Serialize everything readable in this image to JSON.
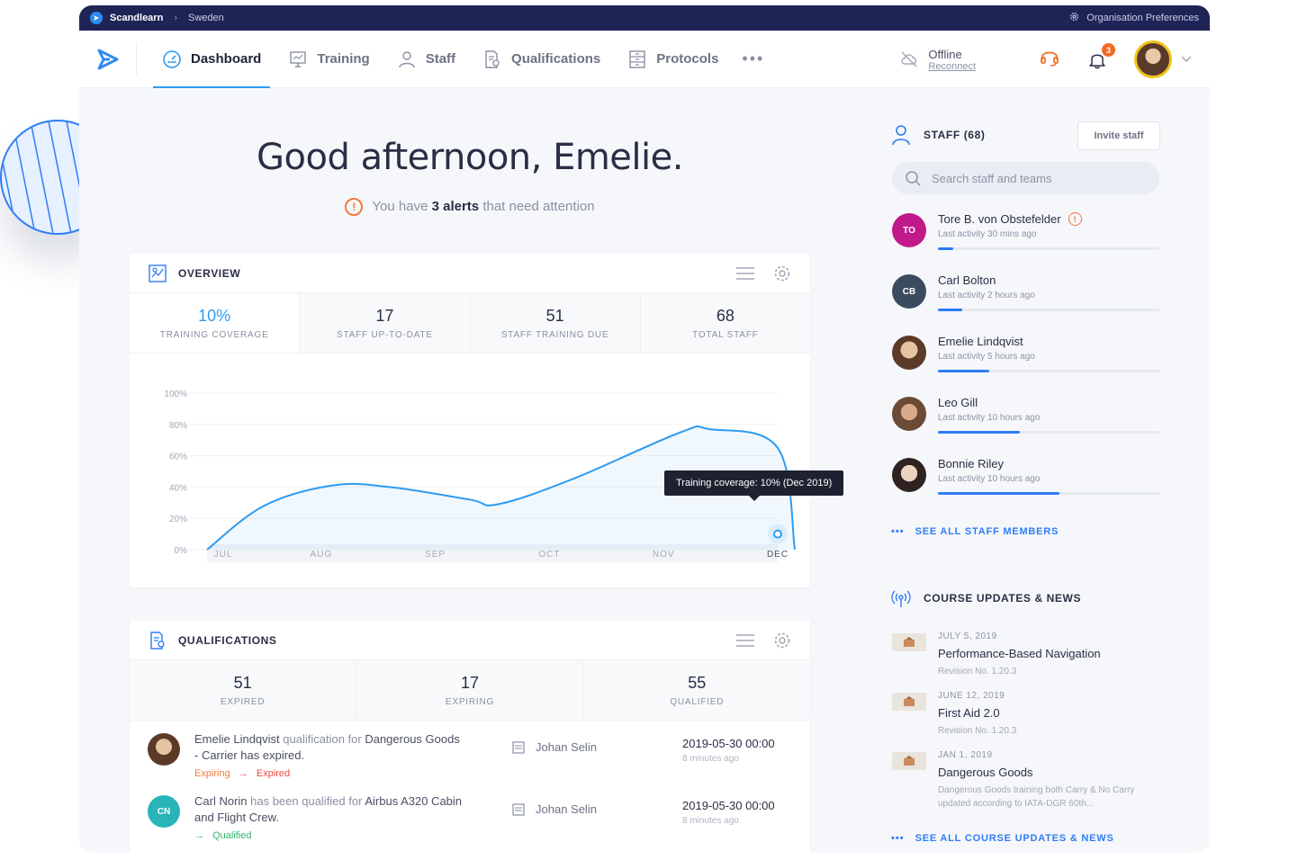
{
  "topbar": {
    "brand": "Scandlearn",
    "breadcrumb": "Sweden",
    "preferences": "Organisation Preferences"
  },
  "nav": {
    "items": [
      {
        "label": "Dashboard",
        "icon": "speedometer-icon",
        "active": true
      },
      {
        "label": "Training",
        "icon": "presentation-icon"
      },
      {
        "label": "Staff",
        "icon": "user-icon"
      },
      {
        "label": "Qualifications",
        "icon": "certificate-icon"
      },
      {
        "label": "Protocols",
        "icon": "cabinet-icon"
      }
    ],
    "more": "•••",
    "offline": {
      "status": "Offline",
      "action": "Reconnect"
    },
    "notifications_count": "3"
  },
  "greeting": {
    "title": "Good afternoon, Emelie.",
    "alert_prefix": "You have",
    "alert_count": "3 alerts",
    "alert_suffix": "that need attention"
  },
  "overview": {
    "title": "OVERVIEW",
    "stats": [
      {
        "value": "10%",
        "label": "TRAINING COVERAGE"
      },
      {
        "value": "17",
        "label": "STAFF UP-TO-DATE"
      },
      {
        "value": "51",
        "label": "STAFF TRAINING DUE"
      },
      {
        "value": "68",
        "label": "TOTAL STAFF"
      }
    ],
    "tooltip": "Training coverage: 10% (Dec 2019)"
  },
  "chart_data": {
    "type": "area",
    "categories": [
      "JUL",
      "AUG",
      "SEP",
      "OCT",
      "NOV",
      "DEC"
    ],
    "x": [
      0,
      0.5,
      1.1,
      1.6,
      2.3,
      2.55,
      3.2,
      4.15,
      4.4,
      5.0,
      5.15
    ],
    "y": [
      0,
      28,
      41,
      40,
      32,
      29,
      45,
      75,
      77,
      65,
      0
    ],
    "ytick_labels": [
      "0%",
      "20%",
      "40%",
      "60%",
      "80%",
      "100%"
    ],
    "ylim": [
      0,
      100
    ],
    "grid": true,
    "line_color": "#2f9bf0",
    "highlight_point": {
      "x": 5.0,
      "y": 10
    }
  },
  "qualifications": {
    "title": "QUALIFICATIONS",
    "stats": [
      {
        "value": "51",
        "label": "EXPIRED"
      },
      {
        "value": "17",
        "label": "EXPIRING"
      },
      {
        "value": "55",
        "label": "QUALIFIED"
      }
    ],
    "rows": [
      {
        "name": "Emelie Lindqvist",
        "text_mid": " qualification for ",
        "qual": "Dangerous Goods - Carrier",
        "text_end": " has expired.",
        "state_from": "Expiring",
        "state_arrow": "→",
        "state_to": "Expired",
        "by": "Johan Selin",
        "date": "2019-05-30 00:00",
        "ago": "8 minutes ago"
      },
      {
        "initials": "CN",
        "name": "Carl Norin",
        "text_mid": " has been qualified for ",
        "qual": "Airbus A320 Cabin and Flight Crew",
        "text_end": ".",
        "state_arrow": "→",
        "state_to": "Qualified",
        "by": "Johan Selin",
        "date": "2019-05-30 00:00",
        "ago": "8 minutes ago"
      }
    ]
  },
  "staff": {
    "title": "STAFF (68)",
    "invite": "Invite staff",
    "search_placeholder": "Search staff and teams",
    "members": [
      {
        "initials": "TO",
        "name": "Tore B. von Obstefelder",
        "activity": "Last activity 30 mins ago",
        "progress": 0.07,
        "alert": true,
        "color": "#c2198a"
      },
      {
        "initials": "CB",
        "name": "Carl Bolton",
        "activity": "Last activity 2 hours ago",
        "progress": 0.11,
        "color": "#3b4a5e"
      },
      {
        "name": "Emelie Lindqvist",
        "activity": "Last activity 5 hours ago",
        "progress": 0.23
      },
      {
        "name": "Leo Gill",
        "activity": "Last activity 10 hours ago",
        "progress": 0.37
      },
      {
        "name": "Bonnie Riley",
        "activity": "Last activity 10 hours ago",
        "progress": 0.55
      }
    ],
    "see_all": "SEE ALL STAFF MEMBERS"
  },
  "news": {
    "title": "COURSE UPDATES & NEWS",
    "items": [
      {
        "date": "JULY 5, 2019",
        "title": "Performance-Based Navigation",
        "desc": "Revision No. 1.20.3"
      },
      {
        "date": "JUNE 12, 2019",
        "title": "First Aid 2.0",
        "desc": "Revision No. 1.20.3"
      },
      {
        "date": "JAN 1, 2019",
        "title": "Dangerous Goods",
        "desc": "Dangerous Goods training both Carry & No Carry updated according to IATA-DGR 60th..."
      }
    ],
    "see_all": "SEE ALL COURSE UPDATES & NEWS"
  },
  "colors": {
    "accent": "#2f9bf0",
    "brand_dark": "#1f2457",
    "warning": "#f07a3a",
    "success": "#2fb86a",
    "danger": "#f04a3a"
  }
}
